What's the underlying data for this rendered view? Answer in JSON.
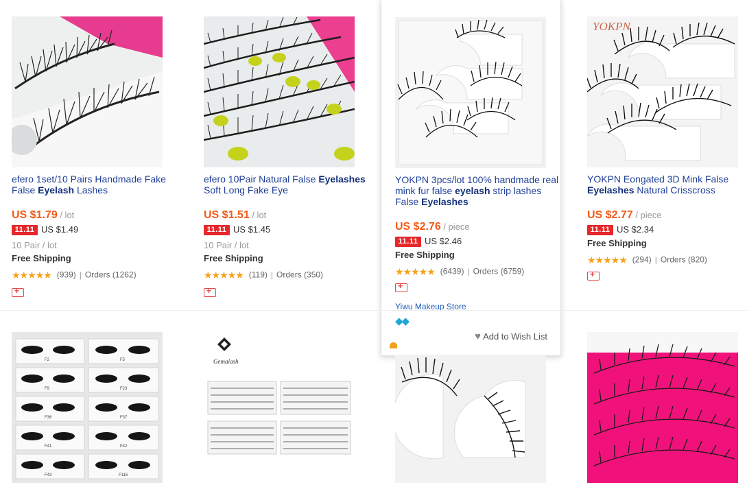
{
  "products": [
    {
      "title_pre": "efero 1set/10 Pairs Handmade Fake False ",
      "title_bold": "Eyelash",
      "title_post": " Lashes",
      "title_bold2": "",
      "price": "US $1.79",
      "unit": " / lot",
      "sale_badge": "11.11",
      "sale_price": "US $1.49",
      "lot_info": "10 Pair / lot",
      "shipping": "Free Shipping",
      "stars": "★★★★★",
      "reviews": "(939)",
      "separator": "|",
      "orders": "Orders (1262)"
    },
    {
      "title_pre": "efero 10Pair Natural False ",
      "title_bold": "Eyelashes",
      "title_post": " Soft Long Fake Eye",
      "title_bold2": "",
      "price": "US $1.51",
      "unit": " / lot",
      "sale_badge": "11.11",
      "sale_price": "US $1.45",
      "lot_info": "10 Pair / lot",
      "shipping": "Free Shipping",
      "stars": "★★★★★",
      "reviews": "(119)",
      "separator": "|",
      "orders": "Orders (350)"
    },
    {
      "title_pre": "YOKPN 3pcs/lot 100% handmade real mink fur false ",
      "title_bold": "eyelash",
      "title_post": " strip lashes False ",
      "title_bold2": "Eyelashes",
      "price": "US $2.76",
      "unit": " / piece",
      "sale_badge": "11.11",
      "sale_price": "US $2.46",
      "shipping": "Free Shipping",
      "stars": "★★★★★",
      "reviews": "(6439)",
      "separator": "|",
      "orders": "Orders (6759)",
      "store": "Yiwu Makeup Store",
      "diamonds": "◆◆",
      "wishlist": "Add to Wish List",
      "heart": "♥"
    },
    {
      "logo_text": "YOKPN",
      "title_pre": "YOKPN Eongated 3D Mink False ",
      "title_bold": "Eyelashes",
      "title_post": " Natural Crisscross",
      "title_bold2": "",
      "price": "US $2.77",
      "unit": " / piece",
      "sale_badge": "11.11",
      "sale_price": "US $2.34",
      "shipping": "Free Shipping",
      "stars": "★★★★★",
      "reviews": "(294)",
      "separator": "|",
      "orders": "Orders (820)"
    }
  ],
  "row2": [
    {
      "labels": [
        "F2",
        "F5",
        "F9",
        "F23",
        "F36",
        "F37",
        "F41",
        "F42",
        "F43",
        "F116"
      ]
    },
    {
      "brand": "Gemalash"
    },
    {},
    {}
  ],
  "colors": {
    "price": "#f45a16",
    "title_link": "#1e3f9a",
    "badge": "#e6282b",
    "stars": "#f7a21c",
    "pink": "#f0127a"
  }
}
